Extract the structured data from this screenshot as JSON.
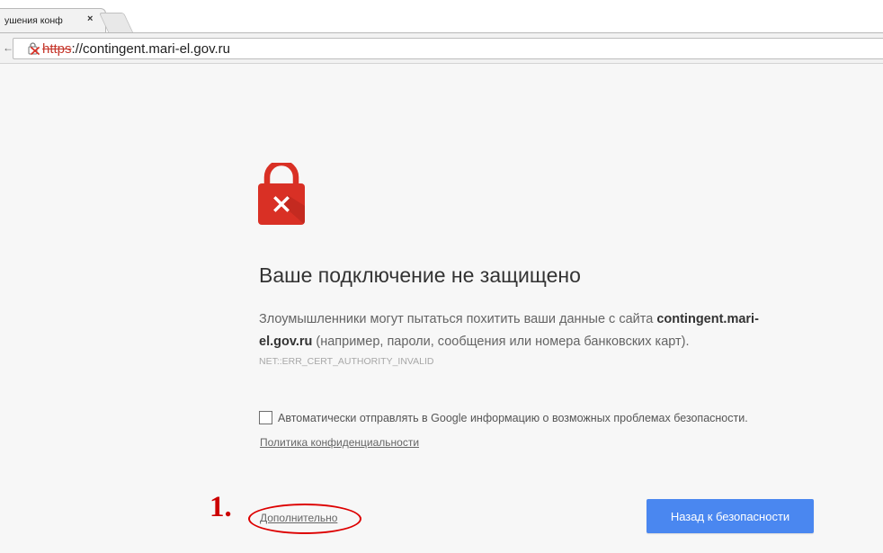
{
  "browser": {
    "tab_title": "ушения конф",
    "tab_close": "×",
    "url_scheme": "https",
    "url_rest": "://contingent.mari-el.gov.ru",
    "back_arrow": "←"
  },
  "interstitial": {
    "icon": "lock-with-x-icon",
    "heading": "Ваше подключение не защищено",
    "explanation_prefix": "Злоумышленники могут пытаться похитить ваши данные с сайта ",
    "explanation_host": "contingent.mari-el.gov.ru",
    "explanation_suffix": " (например, пароли, сообщения или номера банковских карт).",
    "error_code": "NET::ERR_CERT_AUTHORITY_INVALID",
    "checkbox_label": "Автоматически отправлять в Google информацию о возможных проблемах безопасности.",
    "checkbox_checked": false,
    "privacy_link": "Политика конфиденциальности",
    "details_link": "Дополнительно",
    "back_button": "Назад к безопасности"
  },
  "annotation": {
    "number": "1."
  },
  "colors": {
    "lock": "#d93025",
    "button": "#4a87f0",
    "annotation": "#cc0000",
    "background": "#f7f7f7"
  }
}
